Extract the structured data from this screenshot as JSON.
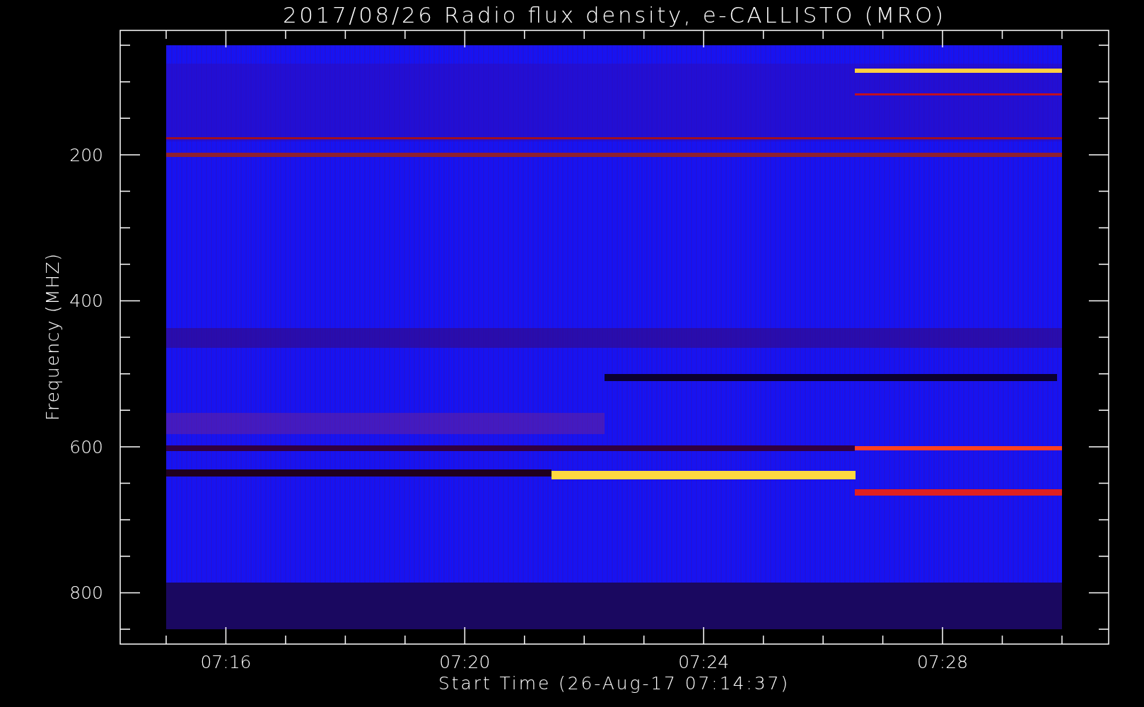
{
  "title": "2017/08/26  Radio flux density, e-CALLISTO (MRO)",
  "plot": {
    "ylabel": "Frequency (MHZ)",
    "xlabel": "Start Time (26-Aug-17 07:14:37)",
    "yticks": [
      "200",
      "400",
      "600",
      "800"
    ],
    "xticks": [
      "07:16",
      "07:20",
      "07:24",
      "07:28"
    ]
  }
}
